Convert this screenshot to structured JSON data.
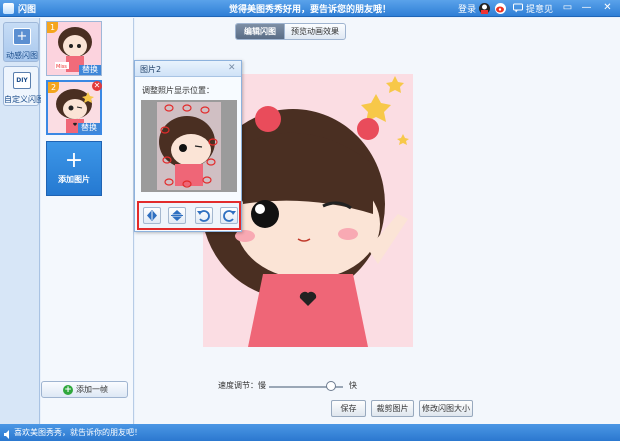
{
  "window": {
    "title": "闪图",
    "slogan": "觉得美图秀秀好用，要告诉您的朋友哦！",
    "login": "登录",
    "feedback": "提意见",
    "controls": [
      "▭",
      "—",
      "✕"
    ]
  },
  "left_tabs": [
    {
      "label": "动感闪图",
      "icon": "+",
      "active": true
    },
    {
      "label": "自定义闪图",
      "icon": "DIY",
      "active": false
    }
  ],
  "thumbnails": [
    {
      "badge": "1",
      "replace_label": "替换"
    },
    {
      "badge": "2",
      "replace_label": "替换"
    }
  ],
  "add_image": {
    "plus": "+",
    "label": "添加图片"
  },
  "add_frame": {
    "label": "添加一帧",
    "icon": "+"
  },
  "top_tabs": [
    {
      "label": "编辑闪图",
      "active": true
    },
    {
      "label": "预览动画效果",
      "active": false
    }
  ],
  "panel": {
    "title": "图片2",
    "close": "✕",
    "description": "调整照片显示位置：",
    "tools": [
      "flip-horizontal-icon",
      "flip-vertical-icon",
      "rotate-left-icon",
      "rotate-right-icon"
    ]
  },
  "speed": {
    "label": "速度调节：慢",
    "fast_label": "快",
    "level": 0.84
  },
  "buttons": {
    "save": "保存",
    "crop": "裁剪图片",
    "resize": "修改闪图大小"
  },
  "status_bar": {
    "text": "喜欢美图秀秀，就告诉你的朋友吧！"
  },
  "colors": {
    "accent": "#2f7fd6",
    "highlight_border": "#e22b2b"
  }
}
